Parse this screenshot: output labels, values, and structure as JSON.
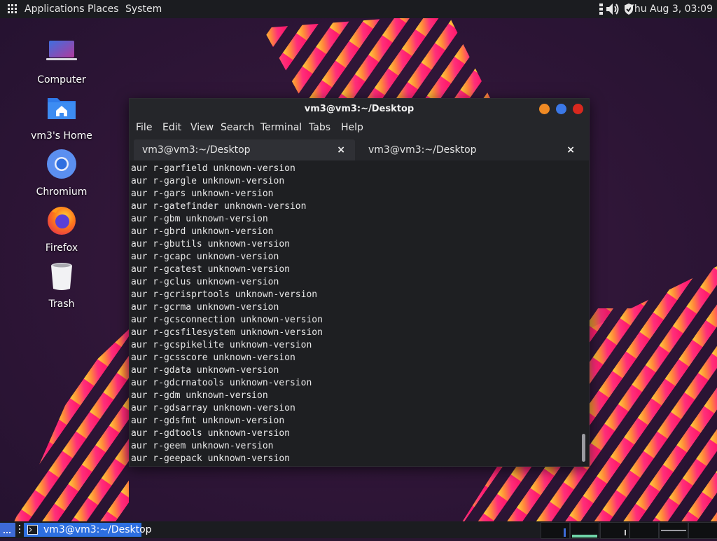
{
  "top_panel": {
    "applications": "Applications",
    "places": "Places",
    "system": "System",
    "clock": "Thu Aug  3, 03:09"
  },
  "desktop_icons": [
    {
      "label": "Computer"
    },
    {
      "label": "vm3's Home"
    },
    {
      "label": "Chromium"
    },
    {
      "label": "Firefox"
    },
    {
      "label": "Trash"
    }
  ],
  "terminal": {
    "title": "vm3@vm3:~/Desktop",
    "menu": [
      "File",
      "Edit",
      "View",
      "Search",
      "Terminal",
      "Tabs",
      "Help"
    ],
    "tabs": [
      {
        "label": "vm3@vm3:~/Desktop",
        "close": "×"
      },
      {
        "label": "vm3@vm3:~/Desktop",
        "close": "×"
      }
    ],
    "lines": [
      "aur r-garfield unknown-version",
      "aur r-gargle unknown-version",
      "aur r-gars unknown-version",
      "aur r-gatefinder unknown-version",
      "aur r-gbm unknown-version",
      "aur r-gbrd unknown-version",
      "aur r-gbutils unknown-version",
      "aur r-gcapc unknown-version",
      "aur r-gcatest unknown-version",
      "aur r-gclus unknown-version",
      "aur r-gcrisprtools unknown-version",
      "aur r-gcrma unknown-version",
      "aur r-gcsconnection unknown-version",
      "aur r-gcsfilesystem unknown-version",
      "aur r-gcspikelite unknown-version",
      "aur r-gcsscore unknown-version",
      "aur r-gdata unknown-version",
      "aur r-gdcrnatools unknown-version",
      "aur r-gdm unknown-version",
      "aur r-gdsarray unknown-version",
      "aur r-gdsfmt unknown-version",
      "aur r-gdtools unknown-version",
      "aur r-geem unknown-version",
      "aur r-geepack unknown-version"
    ]
  },
  "taskbar": {
    "task_label": "vm3@vm3:~/Desktop"
  },
  "colors": {
    "accent": "#2d6fe0",
    "btn_minimize": "#f08a24",
    "btn_maximize": "#3b78e7",
    "btn_close": "#d9281e",
    "wallpaper_bg": "#2a1631"
  }
}
